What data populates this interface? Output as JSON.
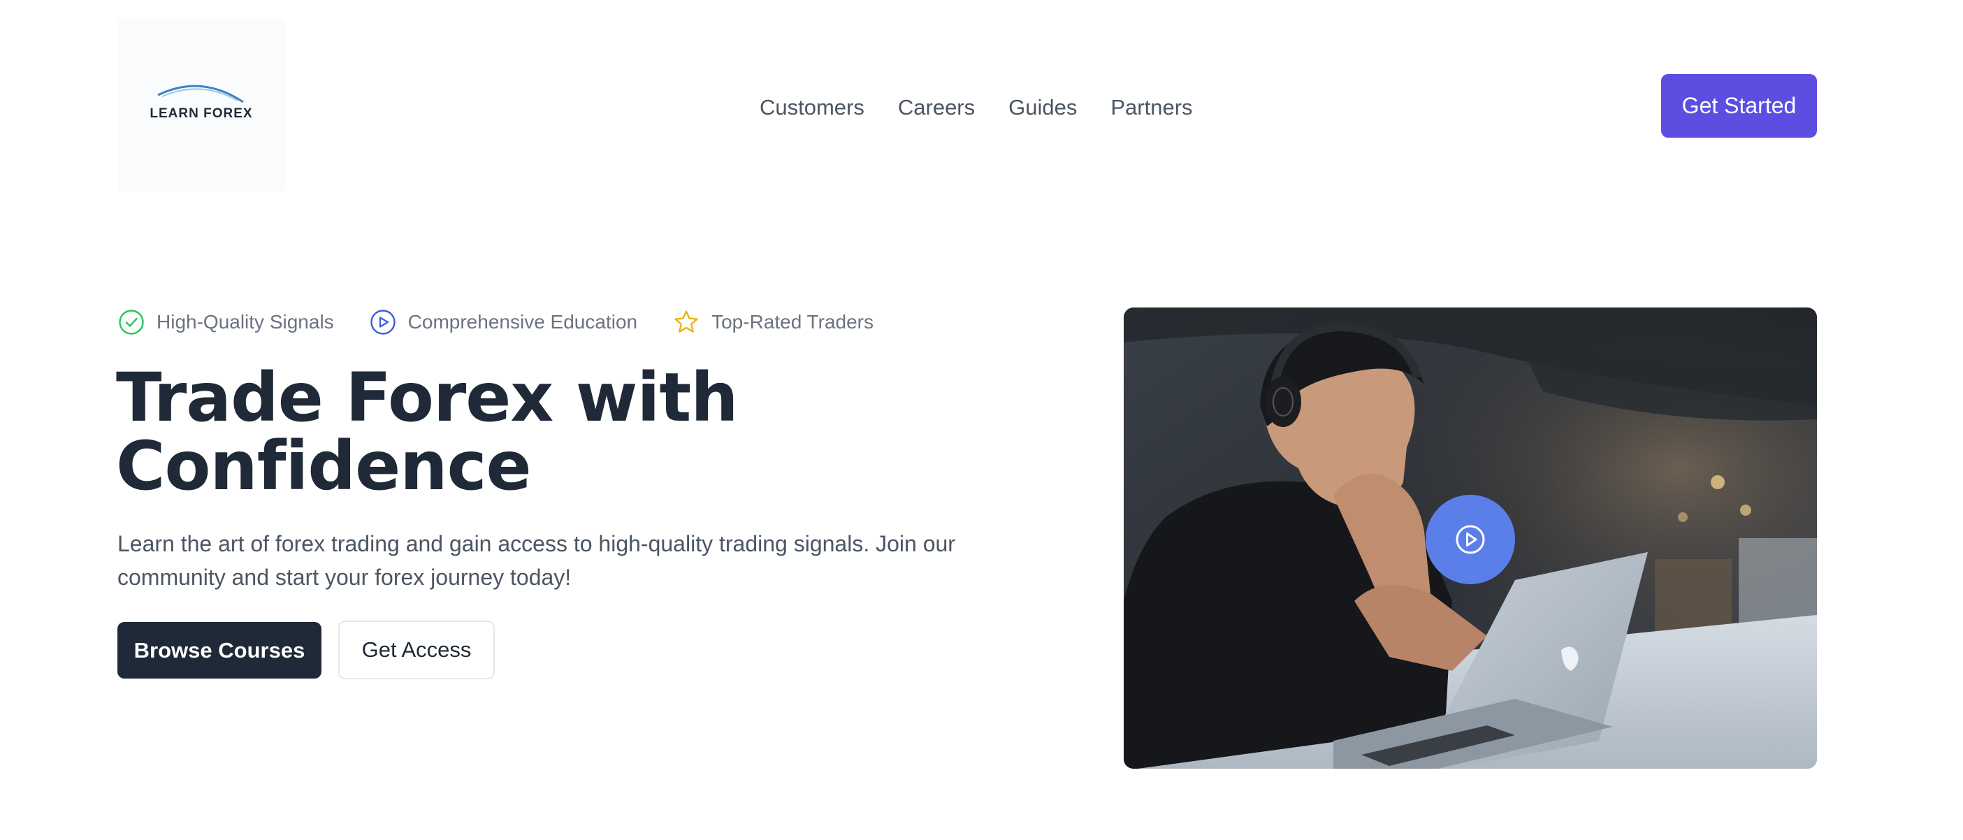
{
  "brand": {
    "logo_text": "LEARN FOREX",
    "accent": "#5b4ee0"
  },
  "nav": {
    "items": [
      {
        "label": "Customers"
      },
      {
        "label": "Careers"
      },
      {
        "label": "Guides"
      },
      {
        "label": "Partners"
      }
    ]
  },
  "header": {
    "cta_label": "Get Started"
  },
  "hero": {
    "features": [
      {
        "icon": "check-circle-icon",
        "label": "High-Quality Signals",
        "color": "#22c55e"
      },
      {
        "icon": "play-circle-icon",
        "label": "Comprehensive Education",
        "color": "#3b5bdb"
      },
      {
        "icon": "star-icon",
        "label": "Top-Rated Traders",
        "color": "#eab308"
      }
    ],
    "title_line1": "Trade Forex with",
    "title_line2": "Confidence",
    "description": "Learn the art of forex trading and gain access to high-quality trading signals. Join our community and start your forex journey today!",
    "primary_button": "Browse Courses",
    "secondary_button": "Get Access",
    "video": {
      "play_icon": "play-circle-icon",
      "play_color": "#5b7fe8"
    }
  }
}
